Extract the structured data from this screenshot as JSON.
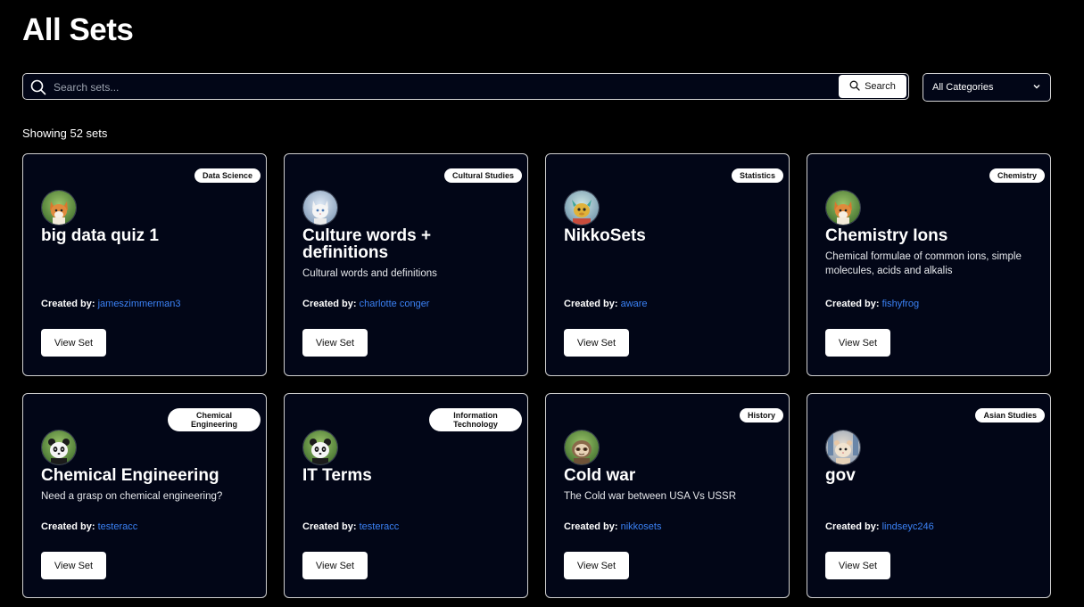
{
  "page": {
    "title": "All Sets"
  },
  "search": {
    "placeholder": "Search sets...",
    "button_label": "Search"
  },
  "filter": {
    "selected": "All Categories"
  },
  "showing_text": "Showing 52 sets",
  "labels": {
    "created_by": "Created by:",
    "view_set": "View Set"
  },
  "colors": {
    "background": "#000000",
    "card": "#020617",
    "link": "#3b82f6"
  },
  "cards": [
    {
      "category": "Data Science",
      "title": "big data quiz 1",
      "description": "",
      "creator": "jameszimmerman3",
      "avatar": "fox-avatar"
    },
    {
      "category": "Cultural Studies",
      "title": "Culture words + definitions",
      "description": "Cultural words and definitions",
      "creator": "charlotte conger",
      "avatar": "cat-avatar"
    },
    {
      "category": "Statistics",
      "title": "NikkoSets",
      "description": "",
      "creator": "aware",
      "avatar": "dragon-avatar"
    },
    {
      "category": "Chemistry",
      "title": "Chemistry Ions",
      "description": "Chemical formulae of common ions, simple molecules, acids and alkalis",
      "creator": "fishyfrog",
      "avatar": "fox-avatar"
    },
    {
      "category": "Chemical Engineering",
      "title": "Chemical Engineering",
      "description": "Need a grasp on chemical engineering?",
      "creator": "testeracc",
      "avatar": "panda-avatar"
    },
    {
      "category": "Information Technology",
      "title": "IT Terms",
      "description": "",
      "creator": "testeracc",
      "avatar": "panda-avatar"
    },
    {
      "category": "History",
      "title": "Cold war",
      "description": "The Cold war between USA Vs USSR",
      "creator": "nikkosets",
      "avatar": "sloth-avatar"
    },
    {
      "category": "Asian Studies",
      "title": "gov",
      "description": "",
      "creator": "lindseyc246",
      "avatar": "hamster-avatar"
    }
  ]
}
